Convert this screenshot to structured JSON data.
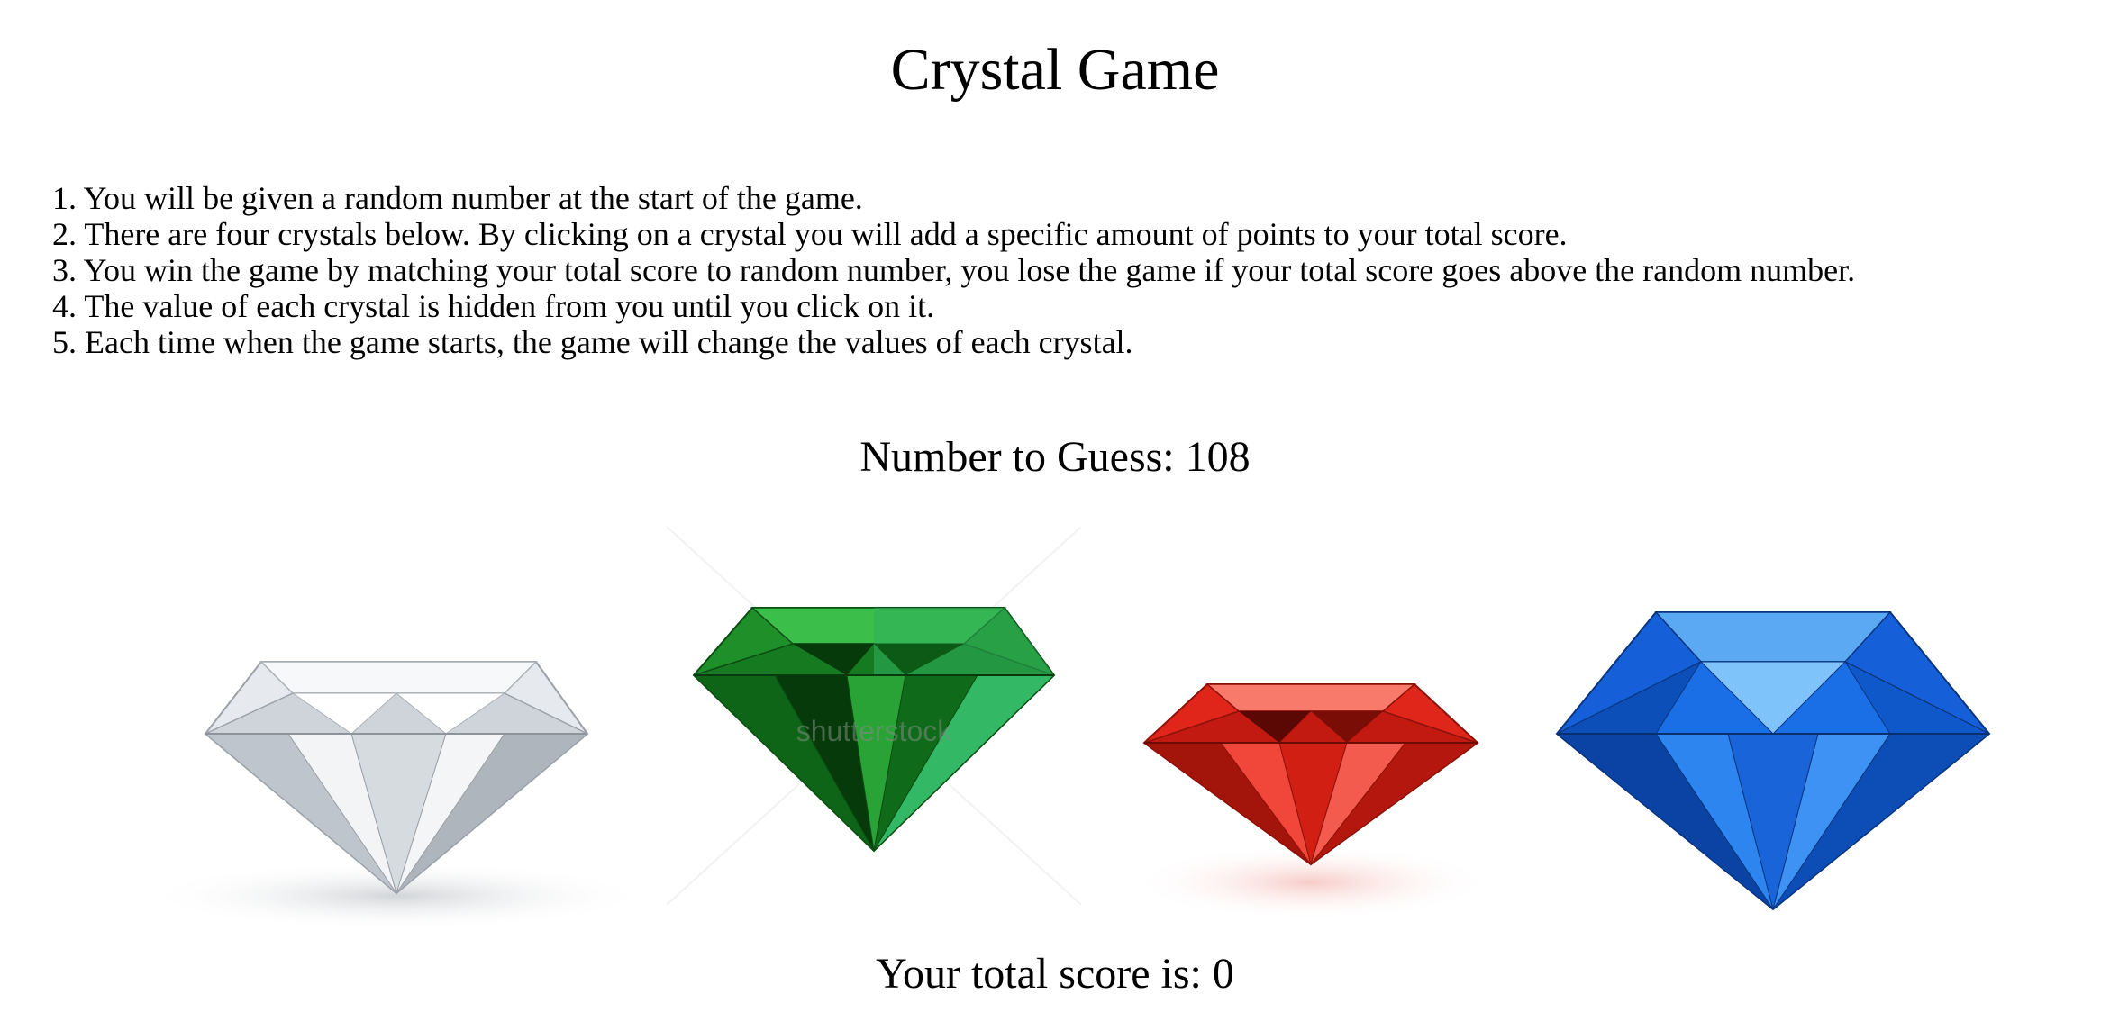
{
  "game": {
    "title": "Crystal Game",
    "rules": [
      "1. You will be given a random number at the start of the game.",
      "2. There are four crystals below. By clicking on a crystal you will add a specific amount of points to your total score.",
      "3. You win the game by matching your total score to random number, you lose the game if your total score goes above the random number.",
      "4. The value of each crystal is hidden from you until you click on it.",
      "5. Each time when the game starts, the game will change the values of each crystal."
    ],
    "target_label": "Number to Guess: 108",
    "score_label": "Your total score is: 0"
  },
  "crystals": [
    {
      "name": "white diamond",
      "color": "#d9dde2"
    },
    {
      "name": "green emerald",
      "color": "#1f8f2a"
    },
    {
      "name": "red ruby",
      "color": "#e0261b"
    },
    {
      "name": "blue sapphire",
      "color": "#1560d8"
    }
  ],
  "watermark": "shutterstock"
}
